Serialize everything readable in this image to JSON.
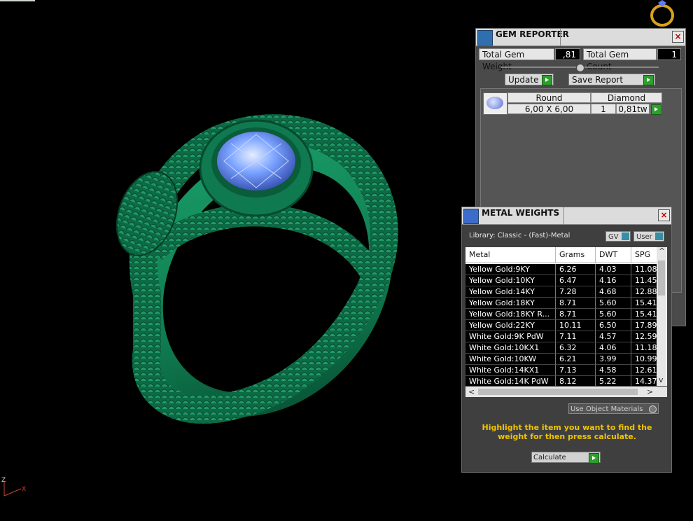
{
  "gem_reporter": {
    "title": "GEM REPORTER",
    "close": "×",
    "total_gem_weight_label": "Total Gem Weight",
    "total_gem_weight_value": ",81",
    "total_gem_count_label": "Total Gem Count",
    "total_gem_count_value": "1",
    "update_label": "Update",
    "save_report_label": "Save Report",
    "gem_row": {
      "shape": "Round",
      "type": "Diamond",
      "size": "6,00 X 6,00",
      "count": "1",
      "weight": "0,81tw"
    }
  },
  "metal_weights": {
    "title": "METAL WEIGHTS",
    "close": "×",
    "library": "Library: Classic - (Fast)-Metal",
    "gv_label": "GV",
    "user_label": "User",
    "columns": [
      "Metal",
      "Grams",
      "DWT",
      "SPG"
    ],
    "rows": [
      [
        "Yellow Gold:9KY",
        "6.26",
        "4.03",
        "11.08"
      ],
      [
        "Yellow Gold:10KY",
        "6.47",
        "4.16",
        "11.45"
      ],
      [
        "Yellow Gold:14KY",
        "7.28",
        "4.68",
        "12.88"
      ],
      [
        "Yellow Gold:18KY",
        "8.71",
        "5.60",
        "15.41"
      ],
      [
        "Yellow Gold:18KY R...",
        "8.71",
        "5.60",
        "15.41"
      ],
      [
        "Yellow Gold:22KY",
        "10.11",
        "6.50",
        "17.89"
      ],
      [
        "White Gold:9K PdW",
        "7.11",
        "4.57",
        "12.59"
      ],
      [
        "White Gold:10KX1",
        "6.32",
        "4.06",
        "11.18"
      ],
      [
        "White Gold:10KW",
        "6.21",
        "3.99",
        "10.99"
      ],
      [
        "White Gold:14KX1",
        "7.13",
        "4.58",
        "12.61"
      ],
      [
        "White Gold:14K PdW",
        "8.12",
        "5.22",
        "14.37"
      ]
    ],
    "use_object_materials": "Use Object Materials",
    "hint": "Highlight the item you want to find the weight for then press calculate.",
    "calculate_label": "Calculate"
  },
  "viewport": {
    "axis_z": "Z",
    "axis_x": "X",
    "ring_color": "#0f7a4f",
    "stone_color": "#7aa2ff"
  }
}
